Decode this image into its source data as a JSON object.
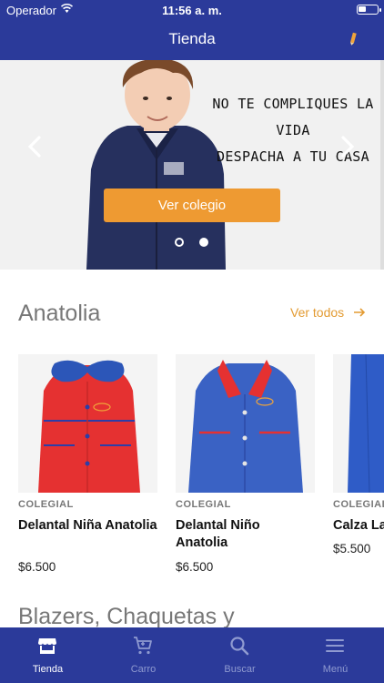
{
  "status_bar": {
    "carrier": "Operador",
    "time": "11:56 a. m.",
    "battery_level": 0.4
  },
  "nav": {
    "title": "Tienda"
  },
  "banner": {
    "text_line_1": "NO TE COMPLIQUES LA VIDA",
    "text_line_2": "DESPACHA A TU CASA",
    "button_label": "Ver colegio"
  },
  "section": {
    "title": "Anatolia",
    "see_all": "Ver todos",
    "products": [
      {
        "brand": "COLEGIAL",
        "name": "Delantal Niña Anatolia",
        "price": "$6.500"
      },
      {
        "brand": "COLEGIAL",
        "name": "Delantal Niño Anatolia",
        "price": "$6.500"
      },
      {
        "brand": "COLEGIAL",
        "name": "Calza La",
        "price": "$5.500"
      }
    ]
  },
  "section_2": {
    "title": "Blazers, Chaquetas y"
  },
  "tabs": [
    {
      "label": "Tienda"
    },
    {
      "label": "Carro"
    },
    {
      "label": "Buscar"
    },
    {
      "label": "Menú"
    }
  ],
  "colors": {
    "primary": "#2b3a9a",
    "accent": "#ee9a32",
    "link": "#e39b32"
  },
  "icons": [
    "wifi-icon",
    "battery-icon",
    "pencil-icon",
    "chevron-left-icon",
    "chevron-right-icon",
    "arrow-right-icon",
    "store-icon",
    "cart-icon",
    "search-icon",
    "menu-icon"
  ]
}
